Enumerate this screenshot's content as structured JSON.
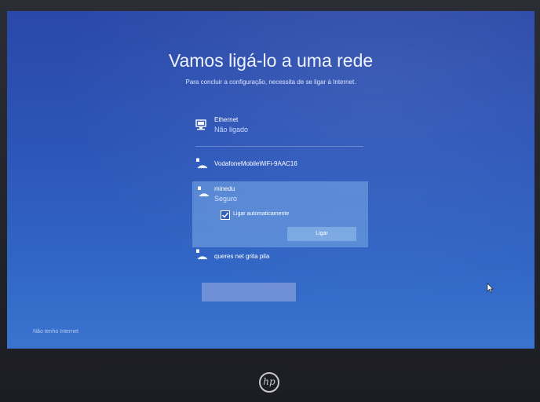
{
  "setup": {
    "title": "Vamos ligá-lo a uma rede",
    "subtitle": "Para concluir a configuração, necessita de se ligar à Internet."
  },
  "networks": [
    {
      "name": "Ethernet",
      "status": "Não ligado",
      "icon": "ethernet-icon"
    },
    {
      "name": "VodafoneMobileWiFi-9AAC16",
      "icon": "wifi-secured-icon"
    },
    {
      "name": "minedu",
      "status": "Seguro",
      "icon": "wifi-secured-icon",
      "selected": true
    },
    {
      "name": "queres net grita pila",
      "icon": "wifi-secured-icon"
    }
  ],
  "selected_network": {
    "auto_connect_label": "Ligar automaticamente",
    "auto_connect_checked": true,
    "connect_label": "Ligar"
  },
  "footer": {
    "no_internet_label": "Não tenho Internet"
  },
  "colors": {
    "background": "#2c55b8",
    "panel": "#78aae6",
    "button": "#7aa7e2",
    "next_button": "#6f8fd6"
  }
}
